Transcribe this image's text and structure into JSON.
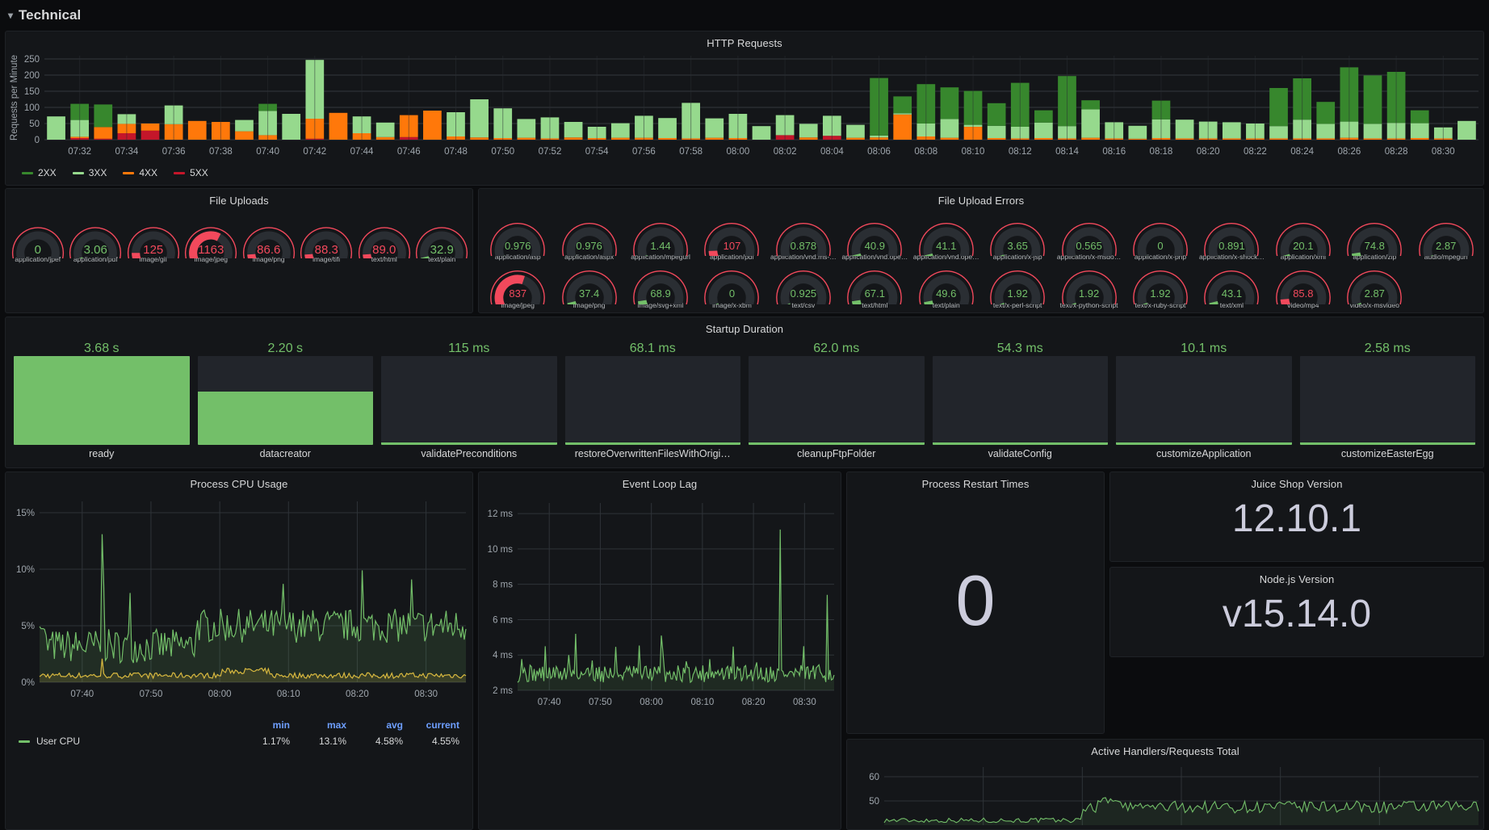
{
  "row": {
    "title": "Technical",
    "collapse_icon": "chevron-down-icon"
  },
  "panels": {
    "http_requests": {
      "title": "HTTP Requests"
    },
    "file_uploads": {
      "title": "File Uploads"
    },
    "file_upload_errors": {
      "title": "File Upload Errors"
    },
    "startup_duration": {
      "title": "Startup Duration"
    },
    "process_cpu": {
      "title": "Process CPU Usage"
    },
    "event_loop_lag": {
      "title": "Event Loop Lag"
    },
    "process_restart": {
      "title": "Process Restart Times",
      "value": "0"
    },
    "juice_shop_version": {
      "title": "Juice Shop Version",
      "value": "12.10.1"
    },
    "nodejs_version": {
      "title": "Node.js Version",
      "value": "v15.14.0"
    },
    "active_handlers": {
      "title": "Active Handlers/Requests Total"
    }
  },
  "colors": {
    "green_2xx": "#37872d",
    "green_3xx": "#96d98d",
    "orange_4xx": "#ff780a",
    "red_5xx": "#c4162a",
    "green_ok": "#73bf69",
    "red_bad": "#f2495c",
    "gauge_track": "#2a2e33",
    "accent_blue": "#6e9fff"
  },
  "chart_data": [
    {
      "type": "bar",
      "id": "http-requests",
      "title": "HTTP Requests",
      "stacked": true,
      "ylabel": "Requests per Minute",
      "xlabel": "",
      "ylim": [
        0,
        260
      ],
      "yticks": [
        0,
        50,
        100,
        150,
        200,
        250
      ],
      "grid": true,
      "legend": [
        "2XX",
        "3XX",
        "4XX",
        "5XX"
      ],
      "legend_position": "bottom-left",
      "categories": [
        "07:31",
        "07:32",
        "07:33",
        "07:34",
        "07:35",
        "07:36",
        "07:37",
        "07:38",
        "07:39",
        "07:40",
        "07:41",
        "07:42",
        "07:43",
        "07:44",
        "07:45",
        "07:46",
        "07:47",
        "07:48",
        "07:49",
        "07:50",
        "07:51",
        "07:52",
        "07:53",
        "07:54",
        "07:55",
        "07:56",
        "07:57",
        "07:58",
        "07:59",
        "08:00",
        "08:01",
        "08:02",
        "08:03",
        "08:04",
        "08:05",
        "08:06",
        "08:07",
        "08:08",
        "08:09",
        "08:10",
        "08:11",
        "08:12",
        "08:13",
        "08:14",
        "08:15",
        "08:16",
        "08:17",
        "08:18",
        "08:19",
        "08:20",
        "08:21",
        "08:22",
        "08:23",
        "08:24",
        "08:25",
        "08:26",
        "08:27",
        "08:28",
        "08:29",
        "08:30",
        "08:31"
      ],
      "xticks": [
        "07:32",
        "07:34",
        "07:36",
        "07:38",
        "07:40",
        "07:42",
        "07:44",
        "07:46",
        "07:48",
        "07:50",
        "07:52",
        "07:54",
        "07:56",
        "07:58",
        "08:00",
        "08:02",
        "08:04",
        "08:06",
        "08:08",
        "08:10",
        "08:12",
        "08:14",
        "08:16",
        "08:18",
        "08:20",
        "08:22",
        "08:24",
        "08:26",
        "08:28",
        "08:30"
      ],
      "series": [
        {
          "name": "5XX",
          "color": "#c4162a",
          "values": [
            0,
            5,
            3,
            20,
            28,
            0,
            0,
            0,
            0,
            0,
            0,
            3,
            0,
            0,
            0,
            8,
            0,
            0,
            0,
            0,
            0,
            0,
            0,
            0,
            0,
            0,
            0,
            0,
            0,
            0,
            0,
            14,
            0,
            12,
            0,
            0,
            0,
            0,
            0,
            0,
            0,
            0,
            0,
            0,
            0,
            0,
            0,
            0,
            0,
            0,
            0,
            0,
            0,
            0,
            0,
            0,
            0,
            0,
            0,
            0,
            0
          ]
        },
        {
          "name": "4XX",
          "color": "#ff780a",
          "values": [
            0,
            4,
            36,
            29,
            22,
            48,
            58,
            55,
            26,
            14,
            0,
            62,
            83,
            20,
            8,
            68,
            90,
            10,
            7,
            5,
            6,
            4,
            7,
            5,
            6,
            6,
            5,
            4,
            6,
            5,
            0,
            0,
            7,
            0,
            6,
            7,
            78,
            10,
            6,
            40,
            5,
            4,
            5,
            4,
            6,
            4,
            3,
            5,
            4,
            4,
            4,
            4,
            4,
            4,
            4,
            6,
            4,
            4,
            5,
            4,
            0
          ]
        },
        {
          "name": "3XX",
          "color": "#96d98d",
          "values": [
            72,
            52,
            0,
            30,
            0,
            58,
            0,
            0,
            35,
            75,
            80,
            182,
            0,
            52,
            45,
            0,
            0,
            75,
            118,
            92,
            58,
            65,
            48,
            35,
            45,
            68,
            62,
            110,
            60,
            75,
            42,
            62,
            42,
            62,
            40,
            6,
            4,
            40,
            58,
            6,
            38,
            36,
            48,
            38,
            88,
            50,
            40,
            58,
            58,
            52,
            50,
            46,
            38,
            58,
            45,
            50,
            45,
            48,
            46,
            34,
            58
          ]
        },
        {
          "name": "2XX",
          "color": "#37872d",
          "values": [
            0,
            50,
            70,
            0,
            0,
            0,
            0,
            0,
            0,
            22,
            0,
            0,
            0,
            0,
            0,
            0,
            0,
            0,
            0,
            0,
            0,
            0,
            0,
            0,
            0,
            0,
            0,
            0,
            0,
            0,
            0,
            0,
            0,
            0,
            0,
            178,
            52,
            122,
            98,
            105,
            70,
            136,
            38,
            155,
            28,
            0,
            0,
            58,
            0,
            0,
            0,
            0,
            118,
            128,
            68,
            168,
            150,
            158,
            40,
            0,
            0
          ]
        }
      ]
    },
    {
      "type": "line",
      "id": "process-cpu",
      "title": "Process CPU Usage",
      "ylabel": "",
      "ylim": [
        0,
        16
      ],
      "yticks": [
        "0%",
        "5%",
        "10%",
        "15%"
      ],
      "ytick_values": [
        0,
        5,
        10,
        15
      ],
      "xticks": [
        "07:40",
        "07:50",
        "08:00",
        "08:10",
        "08:20",
        "08:30"
      ],
      "grid": true,
      "legend": [
        {
          "name": "User CPU",
          "color": "#73bf69",
          "min": "1.17%",
          "max": "13.1%",
          "avg": "4.58%",
          "current": "4.55%"
        }
      ],
      "legend_headers": [
        "min",
        "max",
        "avg",
        "current"
      ],
      "legend_position": "bottom"
    },
    {
      "type": "line",
      "id": "event-loop-lag",
      "title": "Event Loop Lag",
      "ylim": [
        2,
        12.6
      ],
      "yticks": [
        "2 ms",
        "4 ms",
        "6 ms",
        "8 ms",
        "10 ms",
        "12 ms"
      ],
      "ytick_values": [
        2,
        4,
        6,
        8,
        10,
        12
      ],
      "xticks": [
        "07:40",
        "07:50",
        "08:00",
        "08:10",
        "08:20",
        "08:30"
      ],
      "grid": true,
      "peak": 11.1,
      "legend": []
    },
    {
      "type": "line",
      "id": "active-handlers",
      "title": "Active Handlers/Requests Total",
      "ylim": [
        40,
        64
      ],
      "yticks": [
        "50",
        "60"
      ],
      "ytick_values": [
        50,
        60
      ],
      "grid": true,
      "legend": []
    },
    {
      "type": "bar",
      "id": "startup-duration",
      "title": "Startup Duration",
      "categories": [
        "ready",
        "datacreator",
        "validatePreconditions",
        "restoreOverwrittenFilesWithOrigi…",
        "cleanupFtpFolder",
        "validateConfig",
        "customizeApplication",
        "customizeEasterEgg"
      ],
      "value_labels": [
        "3.68 s",
        "2.20 s",
        "115 ms",
        "68.1 ms",
        "62.0 ms",
        "54.3 ms",
        "10.1 ms",
        "2.58 ms"
      ],
      "values_ms": [
        3680,
        2200,
        115,
        68.1,
        62.0,
        54.3,
        10.1,
        2.58
      ],
      "fill_fraction": [
        1.0,
        0.6,
        0.03,
        0.015,
        0.015,
        0.015,
        0.01,
        0.008
      ],
      "unit": "ms",
      "color": "#73bf69"
    },
    {
      "type": "gauge",
      "id": "file-uploads",
      "title": "File Uploads",
      "items": [
        {
          "label": "application/jpef",
          "value": "0",
          "fraction": 0.0,
          "color": "#73bf69"
        },
        {
          "label": "application/pdf",
          "value": "3.06",
          "fraction": 0.03,
          "color": "#73bf69"
        },
        {
          "label": "image/gif",
          "value": "125",
          "fraction": 0.11,
          "color": "#f2495c"
        },
        {
          "label": "image/jpeg",
          "value": "1163",
          "fraction": 0.62,
          "color": "#f2495c"
        },
        {
          "label": "image/png",
          "value": "86.6",
          "fraction": 0.09,
          "color": "#f2495c"
        },
        {
          "label": "image/tiff",
          "value": "88.3",
          "fraction": 0.09,
          "color": "#f2495c"
        },
        {
          "label": "text/html",
          "value": "89.0",
          "fraction": 0.09,
          "color": "#f2495c"
        },
        {
          "label": "text/plain",
          "value": "32.9",
          "fraction": 0.05,
          "color": "#73bf69"
        }
      ]
    },
    {
      "type": "gauge",
      "id": "file-upload-errors",
      "title": "File Upload Errors",
      "items": [
        {
          "label": "application/asp",
          "value": "0.976",
          "fraction": 0.01,
          "color": "#73bf69"
        },
        {
          "label": "application/aspx",
          "value": "0.976",
          "fraction": 0.01,
          "color": "#73bf69"
        },
        {
          "label": "application/mpegurl",
          "value": "1.44",
          "fraction": 0.02,
          "color": "#73bf69"
        },
        {
          "label": "application/pdf",
          "value": "107",
          "fraction": 0.1,
          "color": "#f2495c"
        },
        {
          "label": "application/vnd.ms-…",
          "value": "0.878",
          "fraction": 0.01,
          "color": "#73bf69"
        },
        {
          "label": "application/vnd.ope…",
          "value": "40.9",
          "fraction": 0.05,
          "color": "#73bf69"
        },
        {
          "label": "application/vnd.ope…",
          "value": "41.1",
          "fraction": 0.05,
          "color": "#73bf69"
        },
        {
          "label": "application/x-jsp",
          "value": "3.65",
          "fraction": 0.03,
          "color": "#73bf69"
        },
        {
          "label": "application/x-msdo…",
          "value": "0.565",
          "fraction": 0.01,
          "color": "#73bf69"
        },
        {
          "label": "application/x-php",
          "value": "0",
          "fraction": 0.0,
          "color": "#73bf69"
        },
        {
          "label": "application/x-shock…",
          "value": "0.891",
          "fraction": 0.01,
          "color": "#73bf69"
        },
        {
          "label": "application/xml",
          "value": "20.1",
          "fraction": 0.04,
          "color": "#73bf69"
        },
        {
          "label": "application/zip",
          "value": "74.8",
          "fraction": 0.07,
          "color": "#73bf69"
        },
        {
          "label": "audio/mpegurl",
          "value": "2.87",
          "fraction": 0.02,
          "color": "#73bf69"
        },
        {
          "label": "image/jpeg",
          "value": "837",
          "fraction": 0.58,
          "color": "#f2495c"
        },
        {
          "label": "image/png",
          "value": "37.4",
          "fraction": 0.05,
          "color": "#73bf69"
        },
        {
          "label": "image/svg+xml",
          "value": "68.9",
          "fraction": 0.07,
          "color": "#73bf69"
        },
        {
          "label": "image/x-xbm",
          "value": "0",
          "fraction": 0.0,
          "color": "#73bf69"
        },
        {
          "label": "text/csv",
          "value": "0.925",
          "fraction": 0.01,
          "color": "#73bf69"
        },
        {
          "label": "text/html",
          "value": "67.1",
          "fraction": 0.07,
          "color": "#73bf69"
        },
        {
          "label": "text/plain",
          "value": "49.6",
          "fraction": 0.06,
          "color": "#73bf69"
        },
        {
          "label": "text/x-perl-script",
          "value": "1.92",
          "fraction": 0.02,
          "color": "#73bf69"
        },
        {
          "label": "text/x-python-script",
          "value": "1.92",
          "fraction": 0.02,
          "color": "#73bf69"
        },
        {
          "label": "text/x-ruby-script",
          "value": "1.92",
          "fraction": 0.02,
          "color": "#73bf69"
        },
        {
          "label": "text/xml",
          "value": "43.1",
          "fraction": 0.05,
          "color": "#73bf69"
        },
        {
          "label": "video/mp4",
          "value": "85.8",
          "fraction": 0.09,
          "color": "#f2495c"
        },
        {
          "label": "video/x-msvideo",
          "value": "2.87",
          "fraction": 0.02,
          "color": "#73bf69"
        }
      ]
    }
  ]
}
